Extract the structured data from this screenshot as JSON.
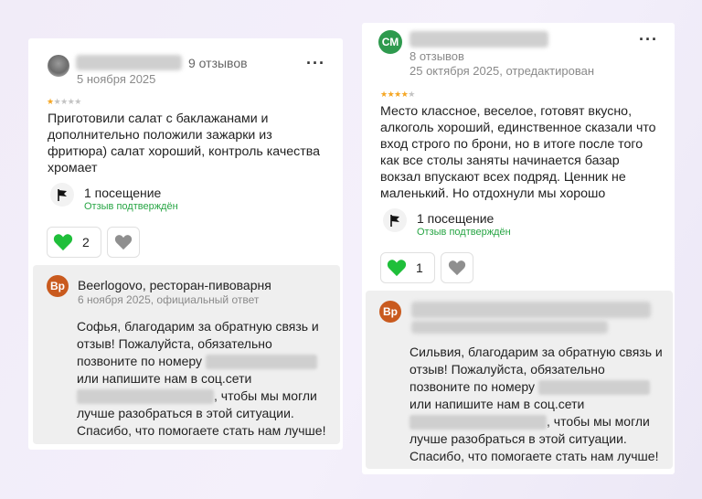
{
  "reviews": [
    {
      "review_count": "9 отзывов",
      "date": "5 ноября 2025",
      "rating": 1,
      "text": "Приготовили салат с баклажанами и дополнительно положили зажарки из фритюра) салат хороший, контроль качества хромает",
      "visits": "1 посещение",
      "verified": "Отзыв подтверждён",
      "likes": "2",
      "reply": {
        "avatar": "Вр",
        "name": "Beerlogovo, ресторан-пивоварня",
        "date": "6 ноября 2025, официальный ответ",
        "text_1": "Софья, благодарим за обратную связь и отзыв! Пожалуйста, обязательно позвоните по номеру",
        "text_2": "или напишите нам в соц.сети",
        "text_3": ", чтобы мы могли лучше разобраться в этой ситуации. Спасибо, что помогаете стать нам лучше!"
      }
    },
    {
      "avatar": "СМ",
      "review_count": "8 отзывов",
      "date": "25 октября 2025, отредактирован",
      "rating": 4,
      "text": "Место классное, веселое, готовят вкусно, алкоголь хороший, единственное сказали что вход строго по брони, но в итоге после того как все столы заняты начинается базар вокзал впускают всех подряд. Ценник не маленький. Но отдохнули мы хорошо",
      "visits": "1 посещение",
      "verified": "Отзыв подтверждён",
      "likes": "1",
      "reply": {
        "avatar": "Вр",
        "text_1": "Сильвия, благодарим за обратную связь и отзыв! Пожалуйста, обязательно позвоните по номеру",
        "text_2": "или напишите нам в соц.сети",
        "text_3": ", чтобы мы могли лучше разобраться в этой ситуации. Спасибо, что помогаете стать нам лучше!"
      }
    }
  ],
  "icons": {
    "more": "more-options-icon",
    "visit": "flag-icon",
    "like": "green-heart-icon",
    "dislike": "grey-heart-icon"
  },
  "colors": {
    "star": "#f5a623",
    "verified": "#27a544",
    "reply_avatar": "#c95a1e",
    "user_avatar": "#2e9a4e",
    "like_heart": "#1fbf3a",
    "dislike_heart": "#8f8f8f"
  }
}
